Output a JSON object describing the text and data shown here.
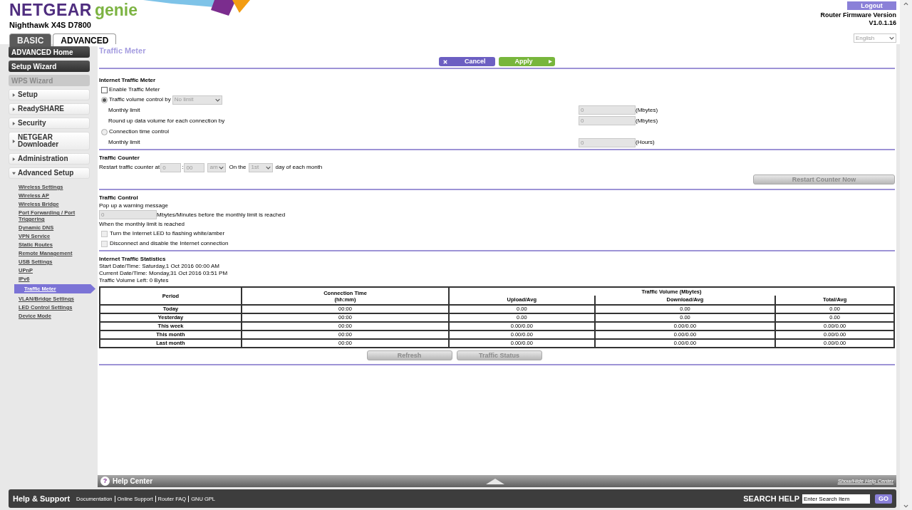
{
  "header": {
    "brand": "NETGEAR",
    "product": "genie",
    "model": "Nighthawk X4S D7800",
    "logout": "Logout",
    "firmware_label": "Router Firmware Version",
    "firmware_version": "V1.0.1.16",
    "language": "English"
  },
  "tabs": [
    {
      "label": "BASIC",
      "selected": false
    },
    {
      "label": "ADVANCED",
      "selected": true
    }
  ],
  "sidebar": {
    "items": [
      {
        "kind": "button",
        "label": "ADVANCED Home",
        "disabled": false
      },
      {
        "kind": "button",
        "label": "Setup Wizard",
        "disabled": false
      },
      {
        "kind": "button",
        "label": "WPS Wizard",
        "disabled": true
      },
      {
        "kind": "section",
        "label": "Setup",
        "expanded": false
      },
      {
        "kind": "section",
        "label": "ReadySHARE",
        "expanded": false
      },
      {
        "kind": "section",
        "label": "Security",
        "expanded": false
      },
      {
        "kind": "section",
        "label": "NETGEAR Downloader",
        "expanded": false
      },
      {
        "kind": "section",
        "label": "Administration",
        "expanded": false
      },
      {
        "kind": "section",
        "label": "Advanced Setup",
        "expanded": true,
        "children": [
          {
            "label": "Wireless Settings",
            "selected": false
          },
          {
            "label": "Wireless AP",
            "selected": false
          },
          {
            "label": "Wireless Bridge",
            "selected": false
          },
          {
            "label": "Port Forwarding / Port Triggering",
            "selected": false
          },
          {
            "label": "Dynamic DNS",
            "selected": false
          },
          {
            "label": "VPN Service",
            "selected": false
          },
          {
            "label": "Static Routes",
            "selected": false
          },
          {
            "label": "Remote Management",
            "selected": false
          },
          {
            "label": "USB Settings",
            "selected": false
          },
          {
            "label": "UPnP",
            "selected": false
          },
          {
            "label": "IPv6",
            "selected": false
          },
          {
            "label": "Traffic Meter",
            "selected": true
          },
          {
            "label": "VLAN/Bridge Settings",
            "selected": false
          },
          {
            "label": "LED Control Settings",
            "selected": false
          },
          {
            "label": "Device Mode",
            "selected": false
          }
        ]
      }
    ]
  },
  "page": {
    "title": "Traffic Meter",
    "cancel": "Cancel",
    "apply": "Apply"
  },
  "internet_traffic_meter": {
    "heading": "Internet Traffic Meter",
    "enable": {
      "label": "Enable Traffic Meter",
      "checked": false
    },
    "volume_control": {
      "label": "Traffic volume control by",
      "selected": true,
      "value": "No limit"
    },
    "monthly_limit": {
      "label": "Monthly limit",
      "value": "0",
      "unit": "(Mbytes)"
    },
    "round_up": {
      "label": "Round up data volume for each connection by",
      "value": "0",
      "unit": "(Mbytes)"
    },
    "time_control": {
      "label": "Connection time control",
      "selected": false
    },
    "time_monthly_limit": {
      "label": "Monthly limit",
      "value": "0",
      "unit": "(Hours)"
    }
  },
  "traffic_counter": {
    "heading": "Traffic Counter",
    "label": "Restart traffic counter at",
    "hour": "0",
    "separator": ":",
    "minute": "00",
    "ampm": "am",
    "on_the": "On the",
    "day": "1st",
    "suffix": "day of each month",
    "restart": "Restart Counter Now"
  },
  "traffic_control": {
    "heading": "Traffic Control",
    "popup_label": "Pop up a warning message",
    "warning_value": "0",
    "warning_suffix": "Mbytes/Minutes before the monthly limit is reached",
    "when_label": "When the monthly limit is reached",
    "options": [
      {
        "label": "Turn the Internet LED to flashing white/amber",
        "checked": false
      },
      {
        "label": "Disconnect and disable the Internet connection",
        "checked": false
      }
    ]
  },
  "statistics": {
    "heading": "Internet Traffic Statistics",
    "lines": [
      "Start Date/Time: Saturday,1 Oct 2016 00:00 AM",
      "Current Date/Time: Monday,31 Oct 2016 03:51 PM",
      "Traffic Volume Left: 0 Bytes"
    ],
    "table": {
      "period_header": "Period",
      "time_header": [
        "Connection Time",
        "(hh:mm)"
      ],
      "volume_header": "Traffic Volume (Mbytes)",
      "volume_columns": [
        "Upload/Avg",
        "Download/Avg",
        "Total/Avg"
      ],
      "rows": [
        [
          "Today",
          "00:00",
          "0.00",
          "0.00",
          "0.00"
        ],
        [
          "Yesterday",
          "00:00",
          "0.00",
          "0.00",
          "0.00"
        ],
        [
          "This week",
          "00:00",
          "0.00/0.00",
          "0.00/0.00",
          "0.00/0.00"
        ],
        [
          "This month",
          "00:00",
          "0.00/0.00",
          "0.00/0.00",
          "0.00/0.00"
        ],
        [
          "Last month",
          "00:00",
          "0.00/0.00",
          "0.00/0.00",
          "0.00/0.00"
        ]
      ]
    },
    "refresh": "Refresh",
    "traffic_status": "Traffic Status"
  },
  "help_bar": {
    "icon": "?",
    "title": "Help Center",
    "toggle": "Show/Hide Help Center"
  },
  "footer": {
    "title": "Help & Support",
    "links": [
      "Documentation",
      "Online Support",
      "Router FAQ",
      "GNU GPL"
    ],
    "search_label": "SEARCH HELP",
    "search_placeholder": "Enter Search Item",
    "go": "GO"
  }
}
